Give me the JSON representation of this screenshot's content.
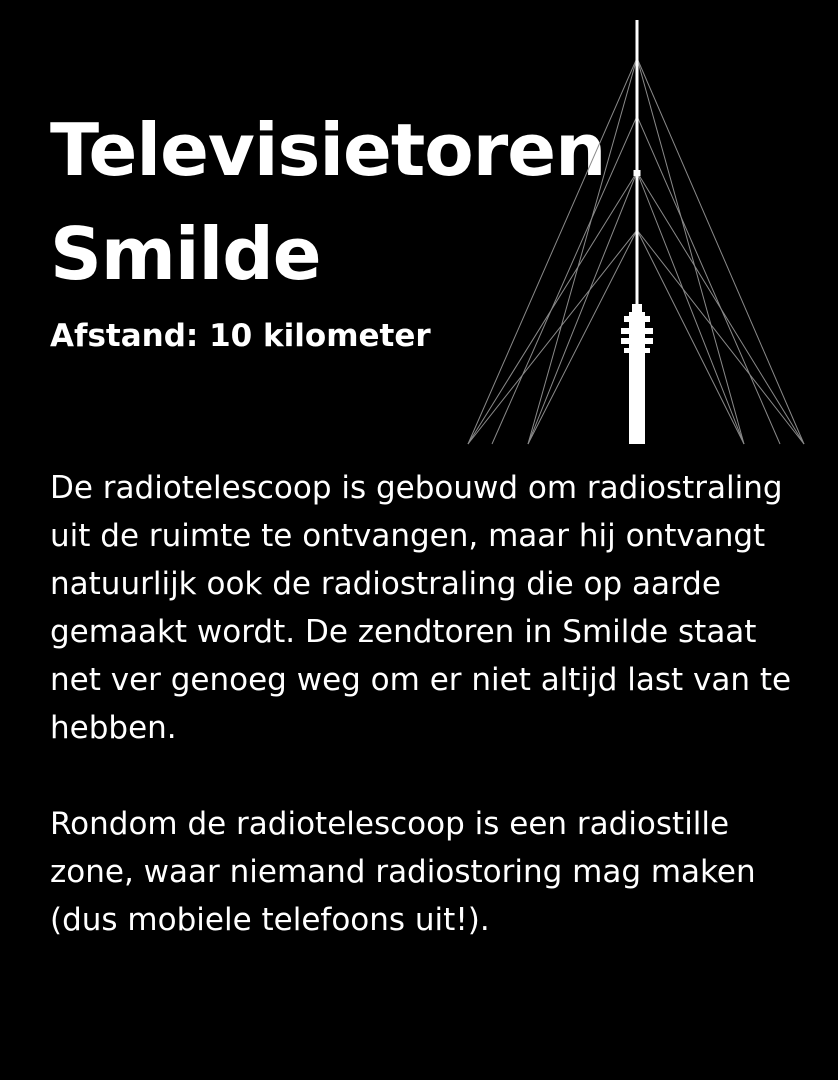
{
  "heading": {
    "title_line1": "Televisietoren",
    "title_line2": "Smilde",
    "distance": "Afstand: 10 kilometer"
  },
  "illustration": {
    "icon": "tv-tower-icon",
    "line_color": "#8a8a8a",
    "tower_color": "#ffffff"
  },
  "body": {
    "paragraph1": "De radiotelescoop is gebouwd om radiostraling uit de ruimte te ontvangen, maar hij ontvangt natuurlijk ook de radiostraling die op aarde gemaakt wordt. De zendtoren in Smilde staat net ver genoeg weg om er niet altijd last van te hebben.",
    "paragraph2": "Rondom de radiotelescoop is een radiostille zone, waar niemand radiostoring mag maken (dus mobiele telefoons uit!)."
  },
  "colors": {
    "background": "#000000",
    "text": "#ffffff"
  }
}
